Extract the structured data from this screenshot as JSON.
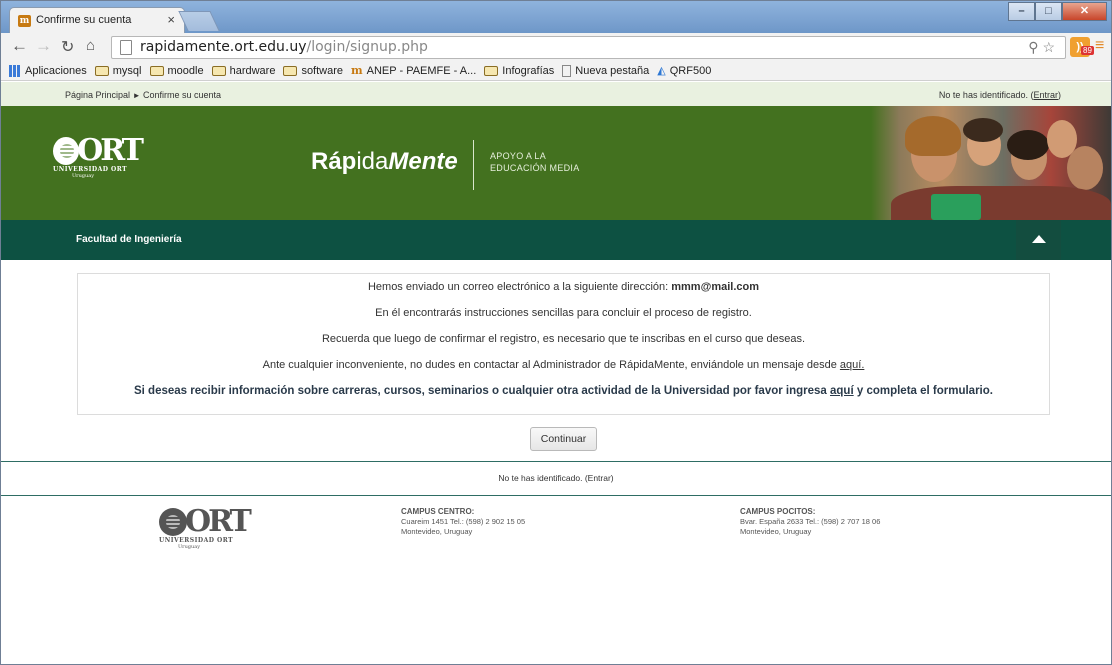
{
  "browser": {
    "tab_title": "Confirme su cuenta",
    "tab_close": "×",
    "url_host": "rapidamente.ort.edu.uy",
    "url_path": "/login/signup.php",
    "rss_badge": "89",
    "bookmarks": [
      {
        "label": "Aplicaciones",
        "icon": "apps-icon"
      },
      {
        "label": "mysql",
        "icon": "folder-icon"
      },
      {
        "label": "moodle",
        "icon": "folder-icon"
      },
      {
        "label": "hardware",
        "icon": "folder-icon"
      },
      {
        "label": "software",
        "icon": "folder-icon"
      },
      {
        "label": "ANEP - PAEMFE - A...",
        "icon": "moodle-icon"
      },
      {
        "label": "Infografías",
        "icon": "folder-icon"
      },
      {
        "label": "Nueva pestaña",
        "icon": "page-icon"
      },
      {
        "label": "QRF500",
        "icon": "qrf-icon"
      }
    ]
  },
  "navbar": {
    "breadcrumb_home": "Página Principal",
    "breadcrumb_sep": "►",
    "breadcrumb_current": "Confirme su cuenta",
    "login_text": "No te has identificado. (",
    "login_link": "Entrar",
    "login_close": ")"
  },
  "banner": {
    "ort_letters": "ORT",
    "ort_sub": "UNIVERSIDAD ORT",
    "ort_sub2": "Uruguay",
    "brand_a": "Ráp",
    "brand_b": "ida",
    "brand_c": "Mente",
    "tagline_1": "APOYO A LA",
    "tagline_2": "EDUCACIÓN MEDIA"
  },
  "course": {
    "name": "Facultad de Ingeniería"
  },
  "notice": {
    "line1_text": "Hemos enviado un correo electrónico a la siguiente dirección: ",
    "line1_email": "mmm@mail.com",
    "line2": "En él encontrarás instrucciones sencillas para concluir el proceso de registro.",
    "line3": "Recuerda que luego de confirmar el registro, es necesario que te inscribas en el curso que deseas.",
    "line4_text": "Ante cualquier inconveniente, no dudes en contactar al Administrador de RápidaMente, enviándole un mensaje desde ",
    "line4_link": "aquí.",
    "line5_text": "Si deseas recibir información sobre carreras, cursos, seminarios o cualquier otra actividad de la Universidad por favor ingresa ",
    "line5_link": "aquí",
    "line5_after": " y completa el formulario."
  },
  "continue_label": "Continuar",
  "footer": {
    "login_text": "No te has identificado. (Entrar)",
    "campus_centro": {
      "title": "CAMPUS CENTRO:",
      "line1": "Cuareim 1451 Tel.: (598) 2 902 15 05",
      "line2": "Montevideo, Uruguay"
    },
    "campus_pocitos": {
      "title": "CAMPUS POCITOS:",
      "line1": "Bvar. España 2633 Tel.: (598) 2 707 18 06",
      "line2": "Montevideo, Uruguay"
    }
  },
  "colors": {
    "banner_green": "#43711f",
    "course_bar": "#0d5142",
    "navbar_bg": "#e9f1e0"
  }
}
